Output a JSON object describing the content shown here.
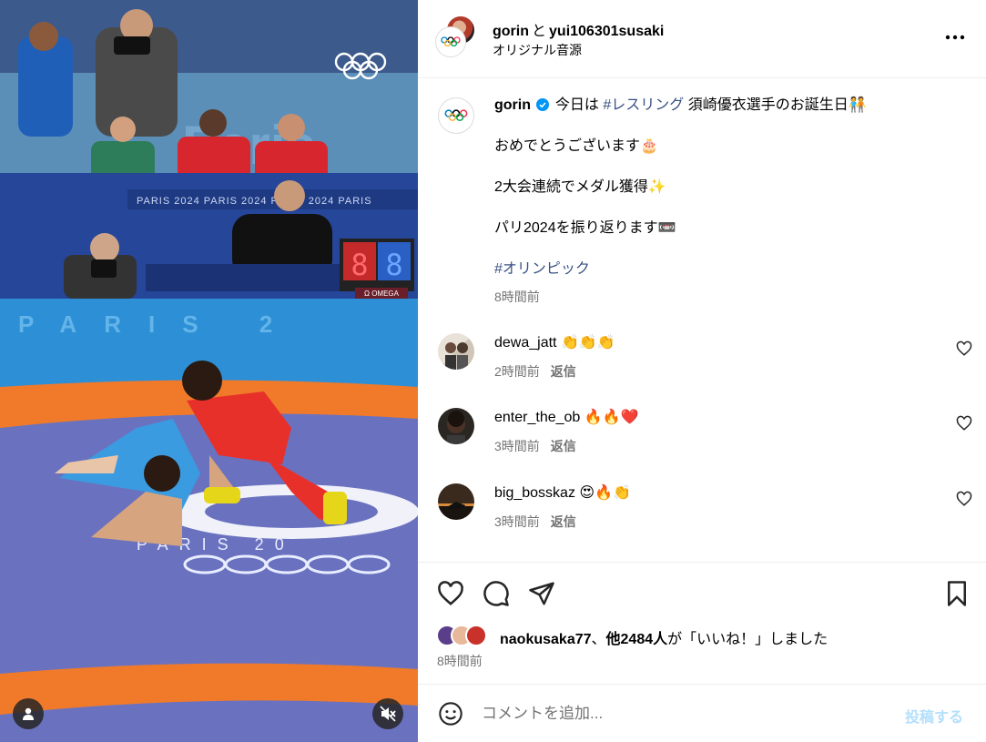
{
  "media": {
    "mute_icon": "speaker-muted-icon",
    "tag_icon": "user-tag-icon"
  },
  "header": {
    "user1": "gorin",
    "separator": "と",
    "user2": "yui106301susaki",
    "audio": "オリジナル音源",
    "more_icon": "more-horizontal-icon"
  },
  "caption": {
    "username": "gorin",
    "intro_prefix": "今日は ",
    "intro_hashtag": "#レスリング",
    "intro_suffix": " 須崎優衣選手のお誕生日🧑‍🤝‍🧑",
    "line2": "おめでとうございます🎂",
    "line3": "2大会連続でメダル獲得✨",
    "line4": "パリ2024を振り返ります📼",
    "hashtag": "#オリンピック",
    "time": "8時間前"
  },
  "comments": [
    {
      "user": "dewa_jatt",
      "text": "👏👏👏",
      "time": "2時間前",
      "reply": "返信"
    },
    {
      "user": "enter_the_ob",
      "text": "🔥🔥❤️",
      "time": "3時間前",
      "reply": "返信"
    },
    {
      "user": "big_bosskaz",
      "text": "😍🔥👏",
      "time": "3時間前",
      "reply": "返信"
    }
  ],
  "likes": {
    "user": "naokusaka77",
    "separator": "、",
    "others": "他2484人",
    "suffix": "が「いいね！」しました",
    "time": "8時間前"
  },
  "comment_box": {
    "placeholder": "コメントを追加...",
    "post_label": "投稿する"
  },
  "colors": {
    "mat_blue": "#6a72c0",
    "mat_orange": "#f07a2a",
    "hashtag": "#385185",
    "post_button": "#b2dffc"
  }
}
